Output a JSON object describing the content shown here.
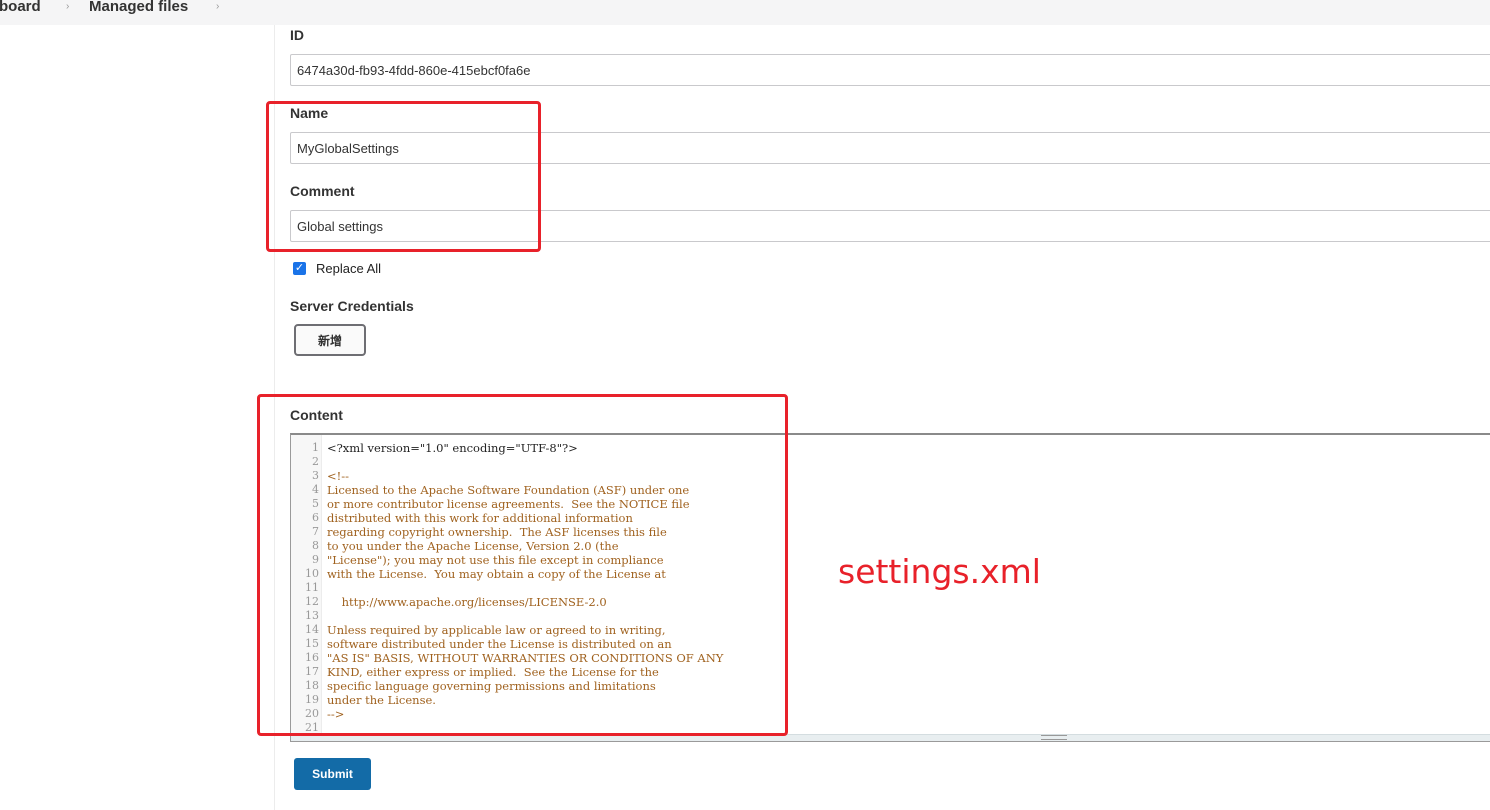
{
  "breadcrumb": {
    "items": [
      "board",
      "Managed files"
    ],
    "separator": "›"
  },
  "form": {
    "id": {
      "label": "ID",
      "value": "6474a30d-fb93-4fdd-860e-415ebcf0fa6e"
    },
    "name": {
      "label": "Name",
      "value": "MyGlobalSettings"
    },
    "comment": {
      "label": "Comment",
      "value": "Global settings"
    },
    "replace_all": {
      "label": "Replace All",
      "checked": true,
      "check_glyph": "✓"
    },
    "server_credentials": {
      "label": "Server Credentials",
      "add_button": "新增"
    },
    "content": {
      "label": "Content",
      "lines": [
        {
          "n": "1",
          "text": "<?xml version=\"1.0\" encoding=\"UTF-8\"?>",
          "style": "plain"
        },
        {
          "n": "2",
          "text": "",
          "style": "plain"
        },
        {
          "n": "3",
          "text": "<!--",
          "style": "comment"
        },
        {
          "n": "4",
          "text": "Licensed to the Apache Software Foundation (ASF) under one",
          "style": "comment"
        },
        {
          "n": "5",
          "text": "or more contributor license agreements.  See the NOTICE file",
          "style": "comment"
        },
        {
          "n": "6",
          "text": "distributed with this work for additional information",
          "style": "comment"
        },
        {
          "n": "7",
          "text": "regarding copyright ownership.  The ASF licenses this file",
          "style": "comment"
        },
        {
          "n": "8",
          "text": "to you under the Apache License, Version 2.0 (the",
          "style": "comment"
        },
        {
          "n": "9",
          "text": "\"License\"); you may not use this file except in compliance",
          "style": "comment"
        },
        {
          "n": "10",
          "text": "with the License.  You may obtain a copy of the License at",
          "style": "comment"
        },
        {
          "n": "11",
          "text": "",
          "style": "comment"
        },
        {
          "n": "12",
          "text": "    http://www.apache.org/licenses/LICENSE-2.0",
          "style": "comment"
        },
        {
          "n": "13",
          "text": "",
          "style": "comment"
        },
        {
          "n": "14",
          "text": "Unless required by applicable law or agreed to in writing,",
          "style": "comment"
        },
        {
          "n": "15",
          "text": "software distributed under the License is distributed on an",
          "style": "comment"
        },
        {
          "n": "16",
          "text": "\"AS IS\" BASIS, WITHOUT WARRANTIES OR CONDITIONS OF ANY",
          "style": "comment"
        },
        {
          "n": "17",
          "text": "KIND, either express or implied.  See the License for the",
          "style": "comment"
        },
        {
          "n": "18",
          "text": "specific language governing permissions and limitations",
          "style": "comment"
        },
        {
          "n": "19",
          "text": "under the License.",
          "style": "comment"
        },
        {
          "n": "20",
          "text": "-->",
          "style": "comment"
        },
        {
          "n": "21",
          "text": "",
          "style": "plain"
        }
      ]
    },
    "submit_label": "Submit"
  },
  "annotation": {
    "text": "settings.xml",
    "color": "#e8212a"
  },
  "colors": {
    "submit_bg": "#136ba7",
    "comment_text": "#a0621f",
    "checkbox": "#1a73e8"
  }
}
